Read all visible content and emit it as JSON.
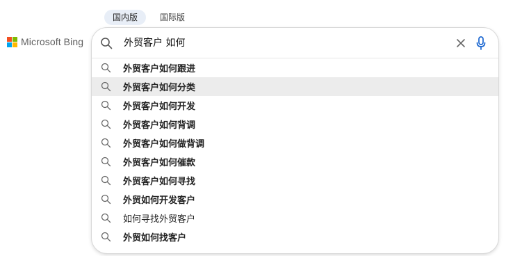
{
  "tabs": [
    {
      "label": "国内版",
      "active": true
    },
    {
      "label": "国际版",
      "active": false
    }
  ],
  "logo": {
    "text": "Microsoft Bing",
    "colors": [
      "#f25022",
      "#7fba00",
      "#00a4ef",
      "#ffb900"
    ]
  },
  "search": {
    "query": "外贸客户 如何",
    "accent": "#1a66d0"
  },
  "suggestions": [
    {
      "label": "外贸客户如何跟进",
      "highlighted": false
    },
    {
      "label": "外贸客户如何分类",
      "highlighted": true
    },
    {
      "label": "外贸客户如何开发",
      "highlighted": false
    },
    {
      "label": "外贸客户如何背调",
      "highlighted": false
    },
    {
      "label": "外贸客户如何做背调",
      "highlighted": false
    },
    {
      "label": "外贸客户如何催款",
      "highlighted": false
    },
    {
      "label": "外贸客户如何寻找",
      "highlighted": false
    },
    {
      "label": "外贸如何开发客户",
      "highlighted": false
    },
    {
      "label": "如何寻找外贸客户",
      "highlighted": false
    },
    {
      "label": "外贸如何找客户",
      "highlighted": false
    }
  ]
}
